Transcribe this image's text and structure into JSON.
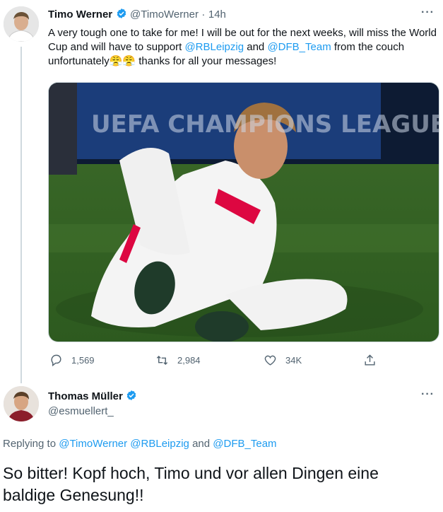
{
  "tweet": {
    "author_name": "Timo Werner",
    "author_handle": "@TimoWerner",
    "separator": "·",
    "time": "14h",
    "more": "···",
    "text_parts": {
      "p1": "A very tough one to take for me! I will be out for the next weeks, will miss the World Cup and will have to support ",
      "mention1": "@RBLeipzig",
      "p2": " and ",
      "mention2": "@DFB_Team",
      "p3": " from the couch unfortunately",
      "emoji": "😤😤",
      "p4": " thanks for all your messages!"
    },
    "media_banner": "UEFA CHAMPIONS LEAGUE",
    "stats": {
      "replies": "1,569",
      "retweets": "2,984",
      "likes": "34K"
    }
  },
  "reply": {
    "author_name": "Thomas Müller",
    "author_handle": "@esmuellert_",
    "more": "···",
    "replying_label": "Replying to ",
    "replying_handles": "@TimoWerner @RBLeipzig",
    "replying_and": " and ",
    "replying_last": "@DFB_Team",
    "text": "So bitter! Kopf hoch, Timo und vor allen Dingen eine baldige Genesung!!"
  },
  "colors": {
    "accent": "#1d9bf0",
    "text": "#0f1419",
    "muted": "#536471",
    "rb_red": "#dd0741"
  }
}
